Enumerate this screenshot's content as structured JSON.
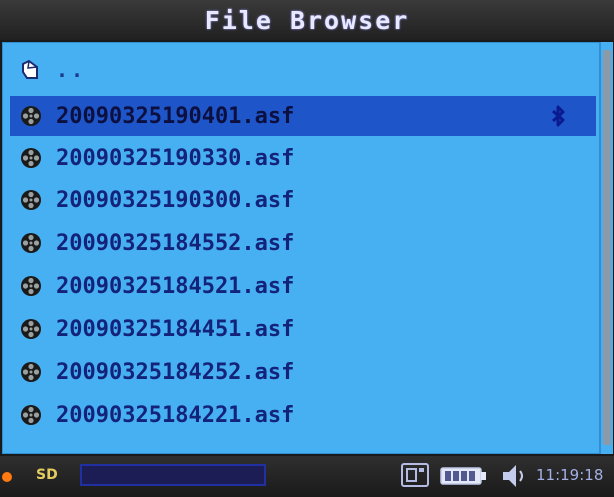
{
  "window": {
    "title": "File Browser"
  },
  "file_list": {
    "parent_entry": {
      "label": "..",
      "icon": "folder-up-icon"
    },
    "files": [
      {
        "name": "20090325190401.asf",
        "icon": "video-reel-icon",
        "selected": true,
        "marker_icon": "bluetooth-icon"
      },
      {
        "name": "20090325190330.asf",
        "icon": "video-reel-icon",
        "selected": false
      },
      {
        "name": "20090325190300.asf",
        "icon": "video-reel-icon",
        "selected": false
      },
      {
        "name": "20090325184552.asf",
        "icon": "video-reel-icon",
        "selected": false
      },
      {
        "name": "20090325184521.asf",
        "icon": "video-reel-icon",
        "selected": false
      },
      {
        "name": "20090325184451.asf",
        "icon": "video-reel-icon",
        "selected": false
      },
      {
        "name": "20090325184252.asf",
        "icon": "video-reel-icon",
        "selected": false
      },
      {
        "name": "20090325184221.asf",
        "icon": "video-reel-icon",
        "selected": false
      }
    ]
  },
  "status_bar": {
    "storage_label": "SD",
    "progress_fraction": 0.0,
    "time": "11:19:18",
    "icons": [
      "sd-card-indicator-icon",
      "memory-card-icon",
      "battery-icon",
      "volume-icon"
    ]
  },
  "colors": {
    "list_background": "#47b0f2",
    "selection": "#1e55c8",
    "filename_text": "#14237a",
    "status_background": "#1f1f1f"
  }
}
